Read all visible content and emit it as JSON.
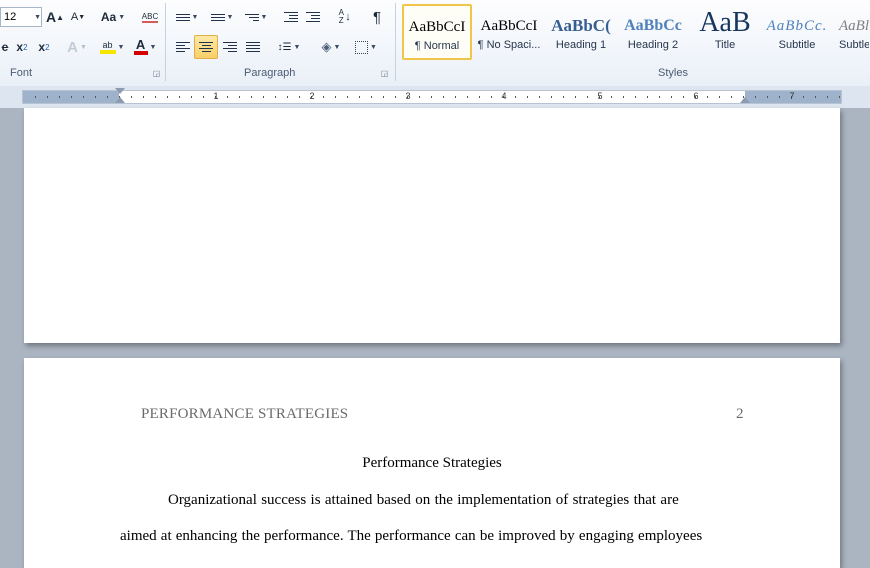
{
  "font_group": {
    "size_value": "12",
    "grow_label": "A",
    "shrink_label": "A",
    "case_label": "Aa",
    "clear_label": "ABC",
    "subscript_label": "x",
    "superscript_label": "x",
    "sub_index": "2",
    "sup_index": "2",
    "strike_label": "e",
    "effects_label": "A",
    "highlight_label": "ab",
    "font_color_label": "A",
    "group_label": "Font"
  },
  "paragraph_group": {
    "sort_label": "A Z",
    "show_marks_label": "¶",
    "group_label": "Paragraph"
  },
  "styles_group": {
    "group_label": "Styles",
    "tiles": [
      {
        "preview": "AaBbCcI",
        "name": "¶ Normal"
      },
      {
        "preview": "AaBbCcI",
        "name": "¶ No Spaci..."
      },
      {
        "preview": "AaBbC(",
        "name": "Heading 1"
      },
      {
        "preview": "AaBbCc",
        "name": "Heading 2"
      },
      {
        "preview": "AaB",
        "name": "Title"
      },
      {
        "preview": "AaBbCc.",
        "name": "Subtitle"
      },
      {
        "preview": "AaBl",
        "name": "Subtle"
      }
    ]
  },
  "ruler": {
    "numbers": [
      "1",
      "2",
      "3",
      "4",
      "5",
      "6",
      "7"
    ]
  },
  "document": {
    "header_left": "PERFORMANCE STRATEGIES",
    "page_number": "2",
    "title": "Performance Strategies",
    "lines": [
      "Organizational success is attained based on the implementation  of strategies that are",
      "aimed at enhancing the performance. The performance can be improved by engaging employees"
    ]
  },
  "colors": {
    "highlight": "#f5e600",
    "font_color": "#d40000",
    "heading": "#365f91"
  }
}
